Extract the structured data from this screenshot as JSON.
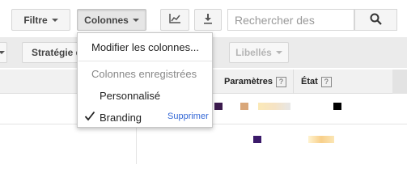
{
  "toolbar": {
    "filter_label": "Filtre",
    "columns_label": "Colonnes",
    "search_placeholder": "Rechercher des",
    "chart_icon": "line-chart-icon",
    "download_icon": "download-icon",
    "search_icon": "magnifier-icon"
  },
  "toolbar2": {
    "strategy_label": "Stratégie d",
    "labels_label": "Libellés"
  },
  "table": {
    "headers": [
      {
        "label": "Paramètres",
        "help": "?"
      },
      {
        "label": "État",
        "help": "?"
      }
    ]
  },
  "columns_menu": {
    "modify_label": "Modifier les colonnes...",
    "saved_heading": "Colonnes enregistrées",
    "items": [
      {
        "label": "Personnalisé",
        "checked": false
      },
      {
        "label": "Branding",
        "checked": true,
        "action": "Supprimer"
      }
    ]
  }
}
